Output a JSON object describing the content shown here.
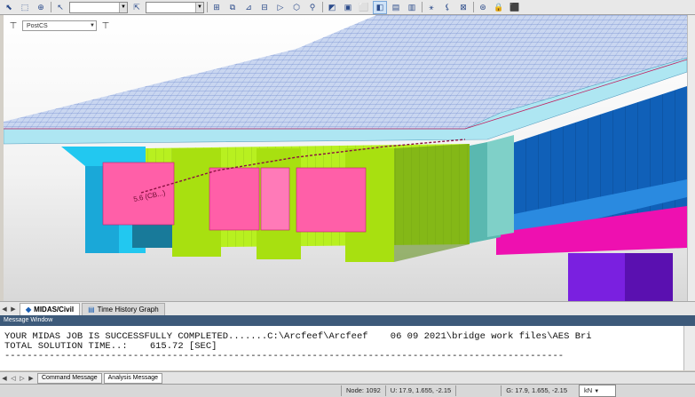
{
  "toolbar": {
    "icons": [
      "select-arrow-icon",
      "select-window-icon",
      "select-polygon-icon",
      "unselect-icon",
      "filter-icon",
      "zoom-window-icon",
      "pan-icon",
      "rotate-icon",
      "view-front-icon",
      "view-top-icon",
      "view-iso-icon",
      "hide-icon",
      "shrink-icon",
      "display-icon",
      "active-icon",
      "render-icon"
    ]
  },
  "ucs": {
    "value": "PostCS"
  },
  "doc_tabs": [
    {
      "label": "MIDAS/Civil",
      "active": true
    },
    {
      "label": "Time History Graph",
      "active": false
    }
  ],
  "message": {
    "title": "Message Window",
    "line1": "YOUR MIDAS JOB IS SUCCESSFULLY COMPLETED.......C:\\Arcfeef\\Arcfeef    06 09 2021\\bridge work files\\AES Bri",
    "line2": "TOTAL SOLUTION TIME..:    615.72 [SEC]",
    "line3": "----------------------------------------------------------------------------------------------------",
    "tabs": [
      "Command Message",
      "Analysis Message"
    ]
  },
  "model": {
    "label": "5.6 (CB...)"
  },
  "status": {
    "node": "Node: 1092",
    "u": "U: 17.9, 1.655, -2.15",
    "g": "G: 17.9, 1.655, -2.15",
    "unit": "kN"
  },
  "colors": {
    "deck": "#aee6f2",
    "girder_cyan": "#22c8f0",
    "diaphragm_lime": "#b8f020",
    "tendon_pink": "#ff5fa8",
    "blue_span": "#1060b8",
    "magenta": "#ee10b0",
    "pier_purple": "#7a20e0"
  }
}
